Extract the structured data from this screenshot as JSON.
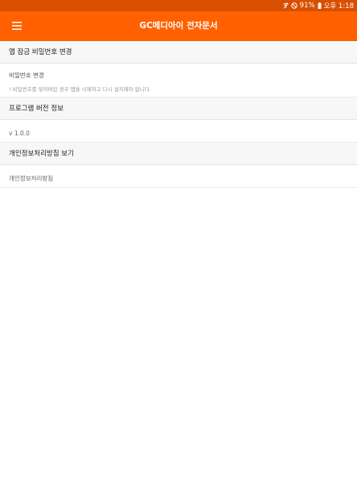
{
  "status_bar": {
    "battery": "91%",
    "time": "오후 1:18",
    "icons": [
      "wifi-off-icon",
      "do-not-disturb-icon",
      "battery-icon"
    ]
  },
  "app_bar": {
    "title": "GC메디아이 전자문서",
    "menu_icon": "hamburger-menu-icon"
  },
  "settings": {
    "lock_section": {
      "header": "앱 잠금 비밀번호 변경",
      "item_title": "비밀번호 변경",
      "item_sub": "! 비밀번호를 잊어버린 경우 앱을 삭제하고 다시 설치해야 합니다."
    },
    "version_section": {
      "header": "프로그램 버전 정보",
      "value": "v 1.0.0"
    },
    "privacy_section": {
      "header": "개인정보처리방침 보기",
      "item_title": "개인정보처리방침"
    }
  },
  "colors": {
    "status_bar": "#d94f00",
    "app_bar": "#ff6100",
    "section_bg": "#f7f7f7"
  }
}
